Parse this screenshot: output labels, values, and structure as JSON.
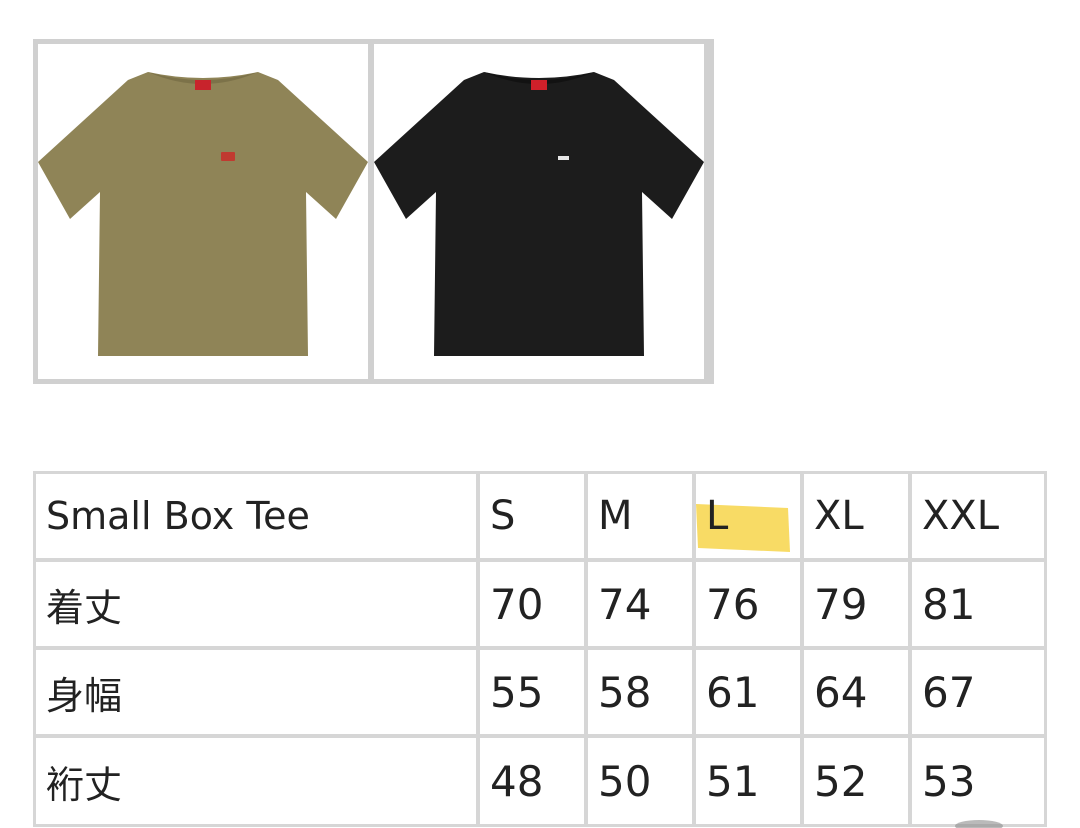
{
  "gallery": {
    "images": [
      {
        "color_name": "khaki",
        "shirt_color": "#8f8457",
        "shirt_shadow": "#7c7249",
        "label_color": "#c8232c",
        "logo_color": "#c03a30"
      },
      {
        "color_name": "black",
        "shirt_color": "#1c1c1c",
        "shirt_shadow": "#121212",
        "label_color": "#d0202a",
        "logo_color": "#e6e6e6"
      }
    ]
  },
  "size_table": {
    "title": "Small Box Tee",
    "sizes": [
      "S",
      "M",
      "L",
      "XL",
      "XXL"
    ],
    "highlighted_size": "L",
    "highlight_color": "#f7d54a",
    "rows": [
      {
        "label": "着丈",
        "values": [
          "70",
          "74",
          "76",
          "79",
          "81"
        ]
      },
      {
        "label": "身幅",
        "values": [
          "55",
          "58",
          "61",
          "64",
          "67"
        ]
      },
      {
        "label": "裄丈",
        "values": [
          "48",
          "50",
          "51",
          "52",
          "53"
        ]
      }
    ]
  }
}
